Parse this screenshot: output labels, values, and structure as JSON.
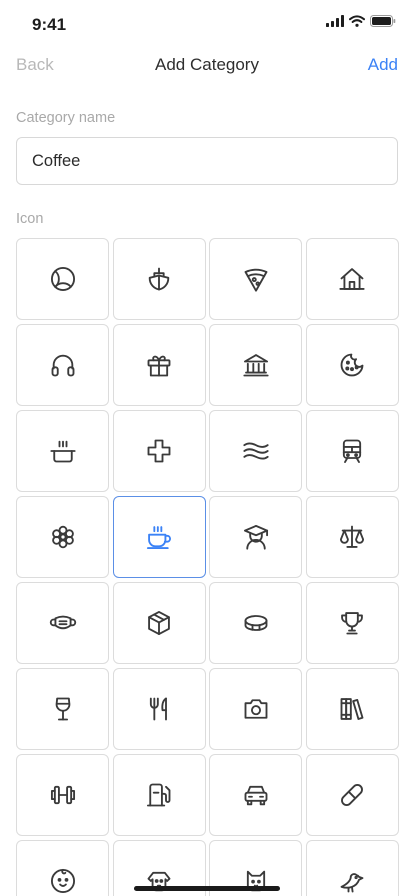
{
  "status": {
    "time": "9:41"
  },
  "nav": {
    "back_label": "Back",
    "title": "Add Category",
    "add_label": "Add"
  },
  "form": {
    "name_label": "Category name",
    "name_value": "Coffee",
    "icon_label": "Icon"
  },
  "icons": [
    "tennis-ball-icon",
    "boat-icon",
    "pizza-slice-icon",
    "house-icon",
    "headphones-icon",
    "gift-icon",
    "bank-icon",
    "cookie-icon",
    "cooking-pot-icon",
    "medical-cross-icon",
    "waves-icon",
    "train-icon",
    "flower-icon",
    "coffee-cup-icon",
    "student-icon",
    "scales-icon",
    "face-mask-icon",
    "package-icon",
    "coin-icon",
    "trophy-icon",
    "wine-glass-icon",
    "fork-knife-icon",
    "camera-icon",
    "books-icon",
    "dumbbell-icon",
    "gas-pump-icon",
    "car-icon",
    "bandage-icon",
    "baby-icon",
    "dog-icon",
    "cat-icon",
    "bird-icon"
  ],
  "selected_icon": "coffee-cup-icon",
  "colors": {
    "accent": "#3b82f6",
    "muted": "#b8b8b8",
    "border": "#dcdcdc"
  }
}
